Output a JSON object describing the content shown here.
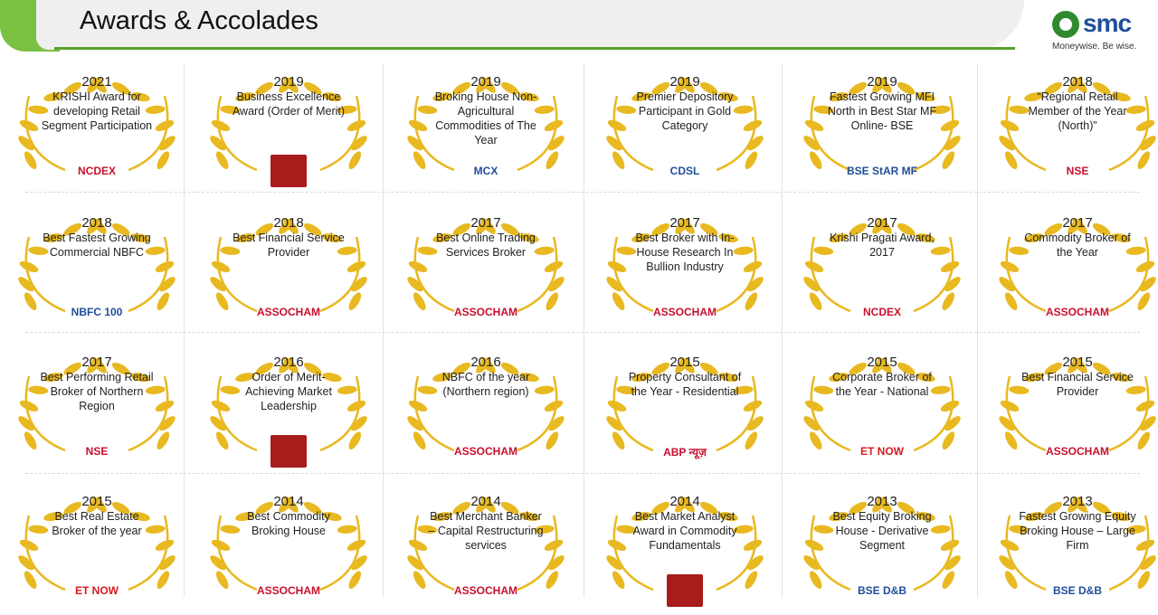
{
  "header": {
    "title": "Awards & Accolades",
    "brand": "smc",
    "tagline": "Moneywise. Be wise."
  },
  "awards": [
    {
      "year": "2021",
      "text": "KRISHI Award for developing Retail Segment Participation",
      "org": "NCDEX"
    },
    {
      "year": "2019",
      "text": "Business Excellence Award (Order of Merit)",
      "org": ""
    },
    {
      "year": "2019",
      "text": "Broking House Non-Agricultural Commodities of The Year",
      "org": "MCX"
    },
    {
      "year": "2019",
      "text": "Premier Depository Participant in Gold Category",
      "org": "CDSL"
    },
    {
      "year": "2019",
      "text": "Fastest Growing MFI North in Best Star MF Online- BSE",
      "org": "BSE StAR MF"
    },
    {
      "year": "2018",
      "text": "“Regional Retail Member of the Year (North)”",
      "org": "NSE"
    },
    {
      "year": "2018",
      "text": "Best Fastest Growing Commercial NBFC",
      "org": "NBFC 100"
    },
    {
      "year": "2018",
      "text": "Best Financial Service Provider",
      "org": "ASSOCHAM"
    },
    {
      "year": "2017",
      "text": "Best Online Trading Services Broker",
      "org": "ASSOCHAM"
    },
    {
      "year": "2017",
      "text": "Best Broker with In-House Research In Bullion Industry",
      "org": "ASSOCHAM"
    },
    {
      "year": "2017",
      "text": "Krishi Pragati Award, 2017",
      "org": "NCDEX"
    },
    {
      "year": "2017",
      "text": "Commodity Broker of the Year",
      "org": "ASSOCHAM"
    },
    {
      "year": "2017",
      "text": "Best Performing Retail Broker of Northern Region",
      "org": "NSE"
    },
    {
      "year": "2016",
      "text": "Order of Merit- Achieving Market Leadership",
      "org": ""
    },
    {
      "year": "2016",
      "text": "NBFC of the year (Northern region)",
      "org": "ASSOCHAM"
    },
    {
      "year": "2015",
      "text": "Property Consultant of the Year - Residential",
      "org": "ABP न्यूज़"
    },
    {
      "year": "2015",
      "text": "Corporate Broker of the Year - National",
      "org": "ET NOW"
    },
    {
      "year": "2015",
      "text": "Best Financial Service Provider",
      "org": "ASSOCHAM"
    },
    {
      "year": "2015",
      "text": "Best Real Estate Broker of the year",
      "org": "ET NOW"
    },
    {
      "year": "2014",
      "text": "Best Commodity Broking House",
      "org": "ASSOCHAM"
    },
    {
      "year": "2014",
      "text": "Best Merchant Banker – Capital Restructuring services",
      "org": "ASSOCHAM"
    },
    {
      "year": "2014",
      "text": "Best Market Analyst Award in Commodity Fundamentals",
      "org": ""
    },
    {
      "year": "2013",
      "text": "Best Equity Broking House - Derivative Segment",
      "org": "BSE D&B"
    },
    {
      "year": "2013",
      "text": "Fastest Growing Equity Broking House – Large Firm",
      "org": "BSE D&B"
    }
  ],
  "colors": {
    "accent": "#7ac142",
    "gold": "#e8b920",
    "brand": "#1f4f9a"
  }
}
